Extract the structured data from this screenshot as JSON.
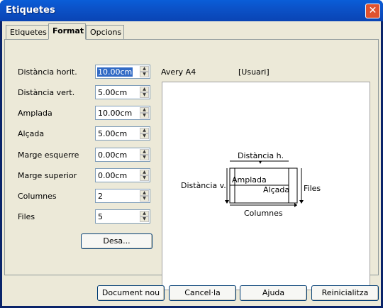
{
  "window": {
    "title": "Etiquetes"
  },
  "tabs": [
    {
      "label": "Etiquetes",
      "active": false
    },
    {
      "label": "Format",
      "active": true
    },
    {
      "label": "Opcions",
      "active": false
    }
  ],
  "format": {
    "brand": "Avery A4",
    "type": "[Usuari]",
    "fields": [
      {
        "label": "Distància horit.",
        "value": "10.00cm",
        "selected": true
      },
      {
        "label": "Distància vert.",
        "value": "5.00cm"
      },
      {
        "label": "Amplada",
        "value": "10.00cm"
      },
      {
        "label": "Alçada",
        "value": "5.00cm"
      },
      {
        "label": "Marge esquerre",
        "value": "0.00cm"
      },
      {
        "label": "Marge superior",
        "value": "0.00cm"
      },
      {
        "label": "Columnes",
        "value": "2"
      },
      {
        "label": "Files",
        "value": "5"
      }
    ],
    "save_label": "Desa..."
  },
  "preview": {
    "horiz_pitch": "Distància h.",
    "vert_pitch": "Distància v.",
    "width": "Amplada",
    "height": "Alçada",
    "columns": "Columnes",
    "rows": "Files"
  },
  "buttons": {
    "new_document": "Document nou",
    "cancel": "Cancel·la",
    "help": "Ajuda",
    "reset": "Reinicialitza"
  },
  "colors": {
    "titlebar": "#0b52c8",
    "dialog_bg": "#ece9d8",
    "selection": "#316ac5"
  }
}
